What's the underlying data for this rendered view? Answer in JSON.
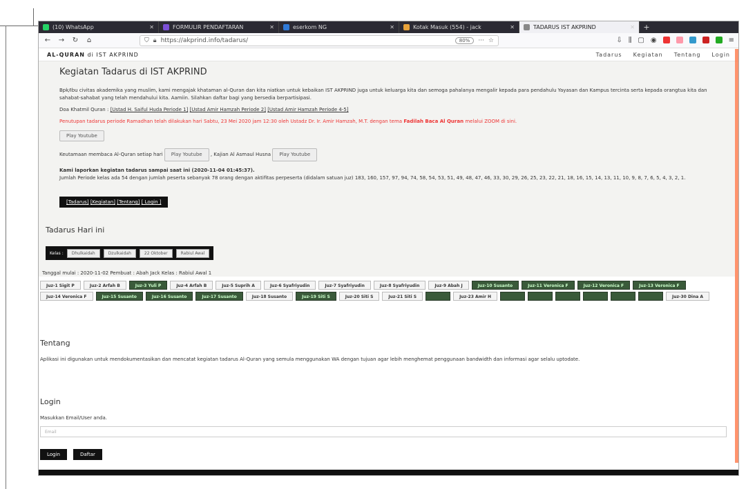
{
  "tabs": [
    {
      "label": "(10) WhatsApp",
      "color": "#25d366"
    },
    {
      "label": "FORMULIR PENDAFTARAN",
      "color": "#7b4fd6"
    },
    {
      "label": "eserkom NG",
      "color": "#2f7ad7"
    },
    {
      "label": "Kotak Masuk (554) - jack",
      "color": "#e8a23a"
    },
    {
      "label": "TADARUS IST AKPRIND",
      "color": "#888888",
      "active": true
    }
  ],
  "url": "https://akprind.info/tadarus/",
  "zoom": "80%",
  "site": {
    "brand_bold": "AL-QURAN",
    "brand_rest": "di IST AKPRIND",
    "nav": [
      "Tadarus",
      "Kegiatan",
      "Tentang",
      "Login"
    ]
  },
  "kegiatan": {
    "title": "Kegiatan Tadarus di IST AKPRIND",
    "intro": "Bpk/Ibu civitas akademika yang muslim, kami mengajak khataman al-Quran dan kita niatkan untuk kebaikan IST AKPRIND juga untuk keluarga kita dan semoga pahalanya mengalir kepada para pendahulu Yayasan dan Kampus tercinta serta kepada orangtua kita dan sahabat-sahabat yang telah mendahului kita. Aamiin. Silahkan daftar bagi yang bersedia berpartisipasi.",
    "doa_label": "Doa Khatmil Quran :",
    "doa_links": [
      "[Ustad H. Saiful Huda Periode 1]",
      "[Ustad Amir Hamzah Periode 2]",
      "[Ustad Amir Hamzah Periode 4-5]"
    ],
    "penutup": "Penutupan tadarus periode Ramadhan telah dilakukan hari Sabtu, 23 Mei 2020 jam 12:30 oleh Ustadz Dr. Ir. Amir Hamzah, M.T. dengan tema",
    "penutup_bold": "Fadilah Baca Al Quran",
    "penutup_end": "melalui ZOOM di sini.",
    "play1": "Play Youtube",
    "keutamaan_label": "Keutamaan membaca Al-Quran setiap hari",
    "play2": "Play Youtube",
    "kajian_label": ", Kajian Al Asmaul Husna",
    "play3": "Play Youtube",
    "laporan_title": "Kami laporkan kegiatan tadarus sampai saat ini (2020-11-04 01:45:37).",
    "laporan_body": "Jumlah Periode kelas ada 54 dengan jumlah peserta sebanyak 78 orang dengan aktifitas perpeserta (didalam satuan juz) 183, 160, 157, 97, 94, 74, 58, 54, 53, 51, 49, 48, 47, 46, 33, 30, 29, 26, 25, 23, 22, 21, 18, 16, 15, 14, 13, 11, 10, 9, 8, 7, 6, 5, 4, 3, 2, 1.",
    "bar": [
      "[Tadarus]",
      "[Kegiatan]",
      "[Tentang]",
      "[ Login ]"
    ]
  },
  "hari_ini": {
    "title": "Tadarus Hari ini",
    "kelas_label": "Kelas :",
    "buttons": [
      "Dhulkaidah",
      "Dzulkaidah",
      "22 Oktober",
      "Rabiul Awal"
    ],
    "tanggal": "Tanggal mulai : 2020-11-02 Pembuat : Abah Jack Kelas : Rabiul Awal 1"
  },
  "juz": [
    {
      "label": "Juz-1 Sigit P",
      "state": "normal"
    },
    {
      "label": "Juz-2 Arfah B",
      "state": "normal"
    },
    {
      "label": "Juz-3 Yuli P",
      "state": "done"
    },
    {
      "label": "Juz-4 Arfah B",
      "state": "normal"
    },
    {
      "label": "Juz-5 Suprih A",
      "state": "normal"
    },
    {
      "label": "Juz-6 Syafriyudin",
      "state": "normal"
    },
    {
      "label": "Juz-7 Syafriyudin",
      "state": "normal"
    },
    {
      "label": "Juz-8 Syafriyudin",
      "state": "normal"
    },
    {
      "label": "Juz-9 Abah J",
      "state": "normal"
    },
    {
      "label": "Juz-10 Susanto",
      "state": "done"
    },
    {
      "label": "Juz-11 Veronica F",
      "state": "done"
    },
    {
      "label": "Juz-12 Veronica F",
      "state": "done"
    },
    {
      "label": "Juz-13 Veronica F",
      "state": "done"
    },
    {
      "label": "Juz-14 Veronica F",
      "state": "normal"
    },
    {
      "label": "Juz-15 Susanto",
      "state": "done"
    },
    {
      "label": "Juz-16 Susanto",
      "state": "done"
    },
    {
      "label": "Juz-17 Susanto",
      "state": "done"
    },
    {
      "label": "Juz-18 Susanto",
      "state": "normal"
    },
    {
      "label": "Juz-19 Siti S",
      "state": "done"
    },
    {
      "label": "Juz-20 Siti S",
      "state": "normal"
    },
    {
      "label": "Juz-21 Siti S",
      "state": "normal"
    },
    {
      "label": "",
      "state": "dark"
    },
    {
      "label": "Juz-23 Amir H",
      "state": "normal"
    },
    {
      "label": "",
      "state": "dark"
    },
    {
      "label": "",
      "state": "dark"
    },
    {
      "label": "",
      "state": "dark"
    },
    {
      "label": "",
      "state": "dark"
    },
    {
      "label": "",
      "state": "dark"
    },
    {
      "label": "",
      "state": "dark"
    },
    {
      "label": "Juz-30 Dina A",
      "state": "normal"
    }
  ],
  "tentang": {
    "title": "Tentang",
    "body": "Aplikasi ini digunakan untuk mendokumentasikan dan mencatat kegiatan tadarus Al-Quran yang semula menggunakan WA dengan tujuan agar lebih menghemat penggunaan bandwidth dan informasi agar selalu uptodate."
  },
  "login": {
    "title": "Login",
    "prompt": "Masukkan Email/User anda.",
    "placeholder": "Email",
    "login_btn": "Login",
    "daftar_btn": "Daftar"
  }
}
